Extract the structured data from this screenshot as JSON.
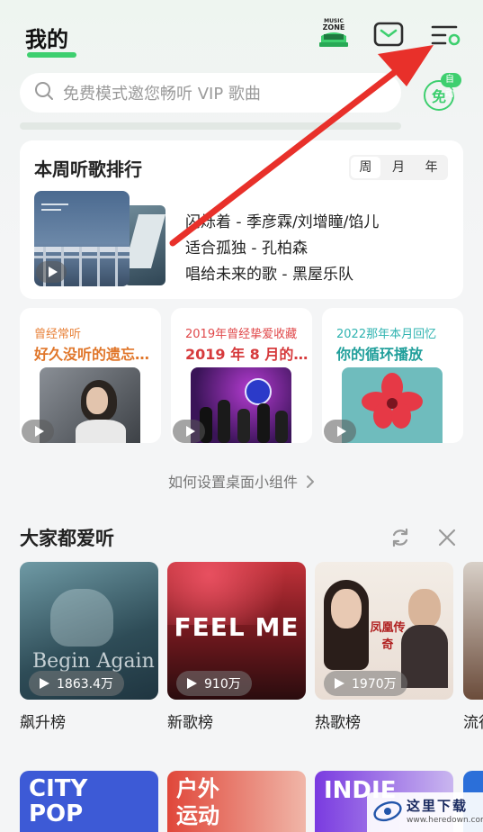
{
  "header": {
    "title": "我的",
    "music_zone_line1": "MUSIC",
    "music_zone_line2": "ZONE"
  },
  "search": {
    "placeholder": "免费模式邀您畅听 VIP 歌曲",
    "free_badge": "免",
    "free_auto": "自动"
  },
  "ranking": {
    "title": "本周听歌排行",
    "tabs": [
      "周",
      "月",
      "年"
    ],
    "songs": [
      "闪烁着 - 季彦霖/刘增瞳/馅儿",
      "适合孤独 - 孔柏森",
      "唱给未来的歌 - 黑屋乐队"
    ]
  },
  "mini_cards": [
    {
      "sub": "曾经常听",
      "main": "好久没听的遗忘…",
      "sub_color": "#e8823a",
      "main_color": "#e0762a"
    },
    {
      "sub": "2019年曾经挚爱收藏",
      "main": "2019 年 8 月的…",
      "sub_color": "#e0484a",
      "main_color": "#d63a3c"
    },
    {
      "sub": "2022那年本月回忆",
      "main": "你的循环播放",
      "sub_color": "#2fb3b0",
      "main_color": "#219f9b"
    }
  ],
  "widget_tip": "如何设置桌面小组件",
  "popular": {
    "title": "大家都爱听",
    "tiles": [
      {
        "label": "飙升榜",
        "count": "1863.4万",
        "art_text": "Begin Again"
      },
      {
        "label": "新歌榜",
        "count": "910万",
        "art_text": "FEEL ME"
      },
      {
        "label": "热歌榜",
        "count": "1970万",
        "art_text": "凤凰传奇"
      },
      {
        "label": "流行"
      }
    ]
  },
  "bottom_tiles": [
    {
      "text_line1": "CITY",
      "text_line2": "POP"
    },
    {
      "text_line1": "户外",
      "text_line2": "运动"
    },
    {
      "text_line1": "INDIE",
      "text_line2": ""
    }
  ],
  "watermark": {
    "name": "这里下载",
    "url": "www.heredown.com"
  },
  "colors": {
    "accent": "#3ecf6f",
    "arrow": "#e8302a"
  }
}
